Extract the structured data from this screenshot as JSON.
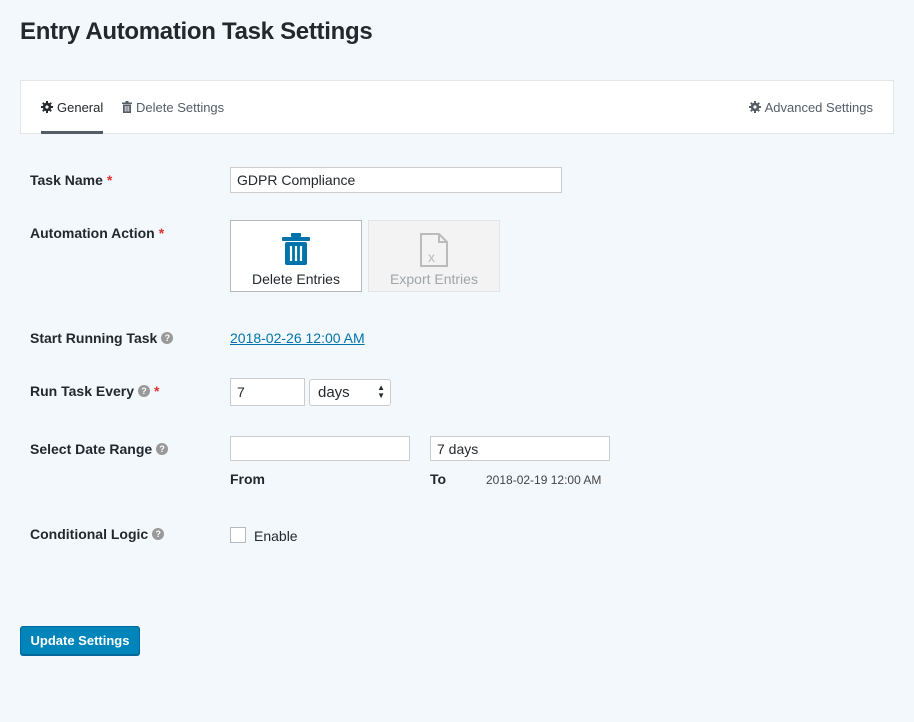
{
  "page": {
    "title": "Entry Automation Task Settings"
  },
  "tabs": [
    {
      "label": "General",
      "icon": "gear-icon",
      "active": true
    },
    {
      "label": "Delete Settings",
      "icon": "trash-icon"
    },
    {
      "label": "Advanced Settings",
      "icon": "gear-icon"
    }
  ],
  "form": {
    "task_name": {
      "label": "Task Name",
      "required": "*",
      "value": "GDPR Compliance"
    },
    "automation_action": {
      "label": "Automation Action",
      "required": "*",
      "options": [
        {
          "label": "Delete Entries",
          "icon": "trash-icon",
          "selected": true,
          "color": "#0073aa"
        },
        {
          "label": "Export Entries",
          "icon": "excel-file-icon",
          "disabled": true
        }
      ]
    },
    "start_running": {
      "label": "Start Running Task",
      "value": "2018-02-26 12:00 AM"
    },
    "run_every": {
      "label": "Run Task Every",
      "required": "*",
      "number": "7",
      "unit": "days"
    },
    "date_range": {
      "label": "Select Date Range",
      "from_value": "",
      "to_value": "7 days",
      "from_label": "From",
      "to_label": "To",
      "to_date": "2018-02-19 12:00 AM"
    },
    "conditional_logic": {
      "label": "Conditional Logic",
      "checkbox_label": "Enable",
      "checked": false
    }
  },
  "actions": {
    "update_label": "Update Settings"
  },
  "colors": {
    "accent": "#0085ba",
    "required": "#dc3232",
    "link": "#0073aa"
  }
}
